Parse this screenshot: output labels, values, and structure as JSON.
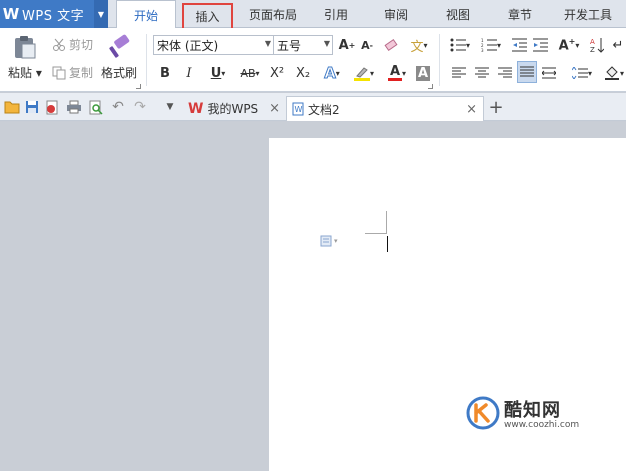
{
  "app": {
    "logo": "W",
    "title": "WPS 文字"
  },
  "tabs": [
    {
      "label": "开始",
      "active": true
    },
    {
      "label": "插入",
      "highlighted": true
    },
    {
      "label": "页面布局"
    },
    {
      "label": "引用"
    },
    {
      "label": "审阅"
    },
    {
      "label": "视图"
    },
    {
      "label": "章节"
    },
    {
      "label": "开发工具"
    }
  ],
  "clipboard": {
    "paste_label": "粘贴",
    "cut_label": "剪切",
    "copy_label": "复制",
    "format_painter_label": "格式刷"
  },
  "font": {
    "family_value": "宋体 (正文)",
    "size_value": "五号",
    "bold": "B",
    "italic": "I",
    "underline": "U",
    "strike": "AB",
    "superscript": "X²",
    "subscript": "X₂",
    "grow": "A",
    "shrink": "A",
    "font_color": "A",
    "char_shade": "A"
  },
  "doc_tabs": [
    {
      "label": "我的WPS",
      "active": false
    },
    {
      "label": "文档2",
      "active": true
    }
  ],
  "add_tab": "+",
  "close_glyph": "×",
  "watermark": {
    "name": "酷知网",
    "url": "www.coozhi.com"
  },
  "colors": {
    "accent": "#3f7ac6",
    "highlight_box": "#e0453f",
    "font_color_bar": "#e02020",
    "highlight_bar": "#f5e300"
  }
}
